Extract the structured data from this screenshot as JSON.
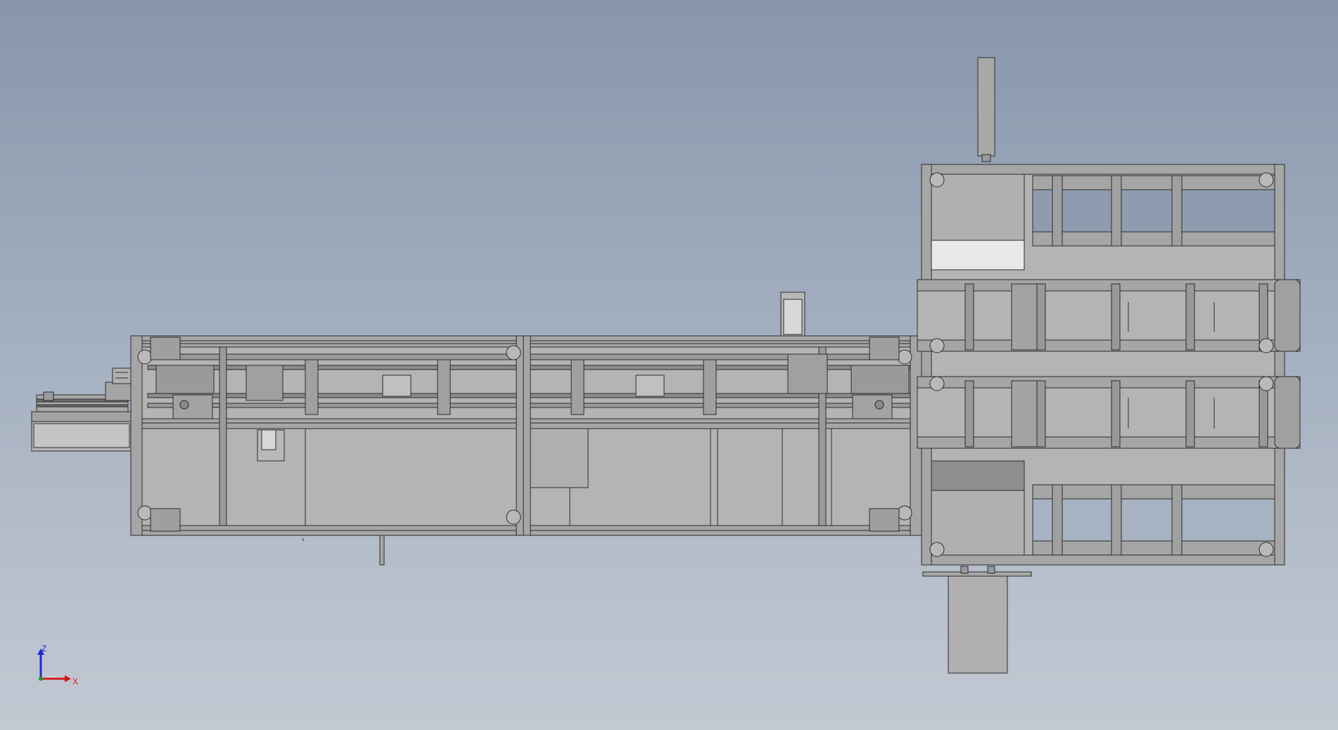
{
  "viewport": {
    "background_top": "#8796aa",
    "background_bottom": "#c3c9d3"
  },
  "model": {
    "frame_color": "#a6a6a6",
    "panel_color": "#b4b4b4",
    "edge_color": "#2b2b2b"
  },
  "triad": {
    "z_label": "Z",
    "x_label": "X",
    "z_color": "#1a2ad0",
    "x_color": "#d01a1a",
    "y_color": "#1a9a2a"
  }
}
